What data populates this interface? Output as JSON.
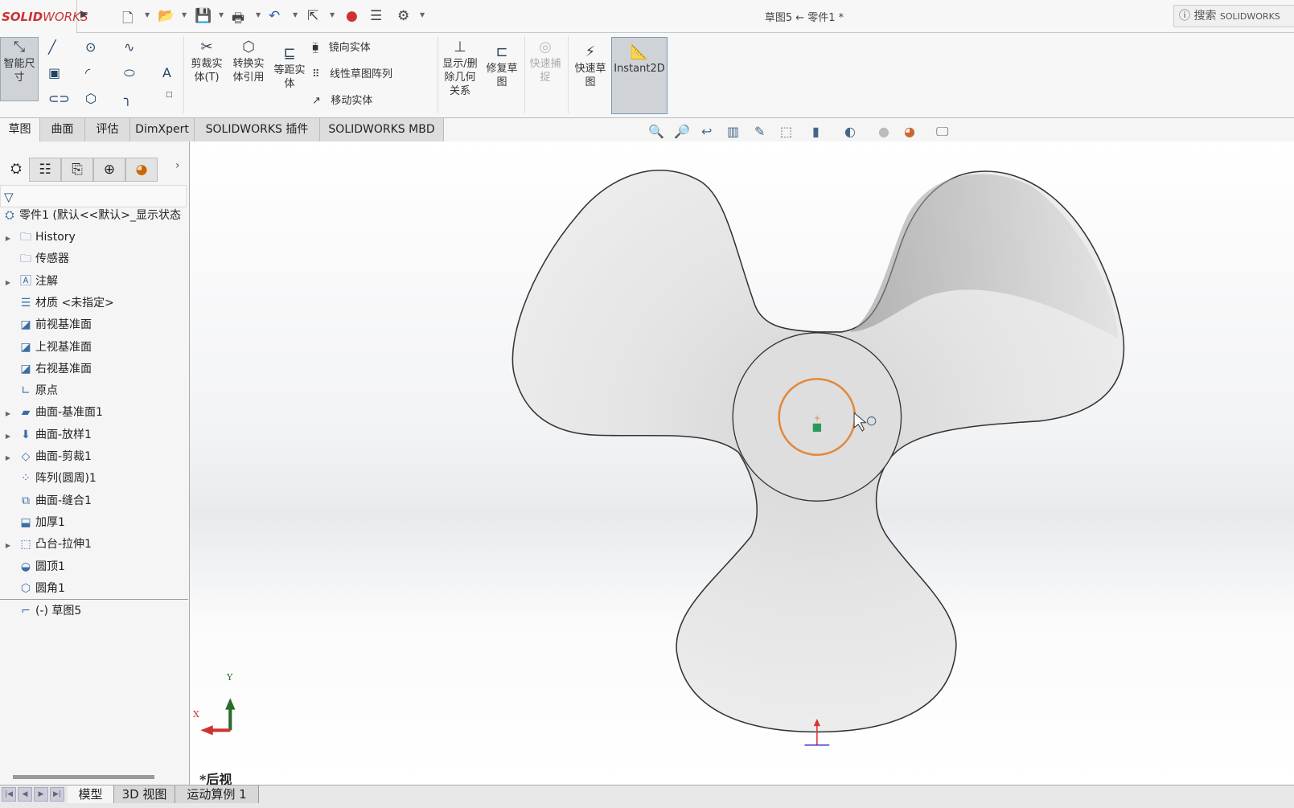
{
  "app": {
    "logo": "SOLIDWORKS",
    "title": "草图5 ← 零件1 *",
    "search_placeholder": "搜索",
    "search_suffix": "SOLIDWORKS"
  },
  "quick_access": [
    "new-icon",
    "open-icon",
    "save-icon",
    "print-icon",
    "undo-icon",
    "select-icon",
    "rebuild-icon",
    "file-properties-icon",
    "options-icon"
  ],
  "ribbon": {
    "smart_dimension": "智能尺寸",
    "trim": "剪裁实体(T)",
    "convert": "转换实体引用",
    "offset": "等距实体",
    "mirror": "镜向实体",
    "linear_pattern": "线性草图阵列",
    "move": "移动实体",
    "display_delete": "显示/删除几何关系",
    "repair": "修复草图",
    "quick_snaps": "快速捕捉",
    "rapid_sketch": "快速草图",
    "instant2d": "Instant2D"
  },
  "command_tabs": [
    {
      "label": "草图",
      "active": true
    },
    {
      "label": "曲面"
    },
    {
      "label": "评估"
    },
    {
      "label": "DimXpert"
    },
    {
      "label": "SOLIDWORKS 插件"
    },
    {
      "label": "SOLIDWORKS MBD"
    }
  ],
  "feature_tree": {
    "root": "零件1  (默认<<默认>_显示状态",
    "items": [
      {
        "label": "History",
        "expandable": true
      },
      {
        "label": "传感器"
      },
      {
        "label": "注解",
        "expandable": true
      },
      {
        "label": "材质 <未指定>"
      },
      {
        "label": "前视基准面"
      },
      {
        "label": "上视基准面"
      },
      {
        "label": "右视基准面"
      },
      {
        "label": "原点"
      },
      {
        "label": "曲面-基准面1",
        "expandable": true
      },
      {
        "label": "曲面-放样1",
        "expandable": true
      },
      {
        "label": "曲面-剪裁1",
        "expandable": true
      },
      {
        "label": "阵列(圆周)1"
      },
      {
        "label": "曲面-缝合1"
      },
      {
        "label": "加厚1"
      },
      {
        "label": "凸台-拉伸1",
        "expandable": true
      },
      {
        "label": "圆顶1"
      },
      {
        "label": "圆角1"
      }
    ],
    "sketch": "(-) 草图5"
  },
  "viewport": {
    "view_name": "*后视",
    "triad_x": "X",
    "triad_y": "Y",
    "sketch_circle_color": "#e08a3c"
  },
  "bottom_tabs": [
    {
      "label": "模型",
      "active": true
    },
    {
      "label": "3D 视图"
    },
    {
      "label": "运动算例 1"
    }
  ]
}
